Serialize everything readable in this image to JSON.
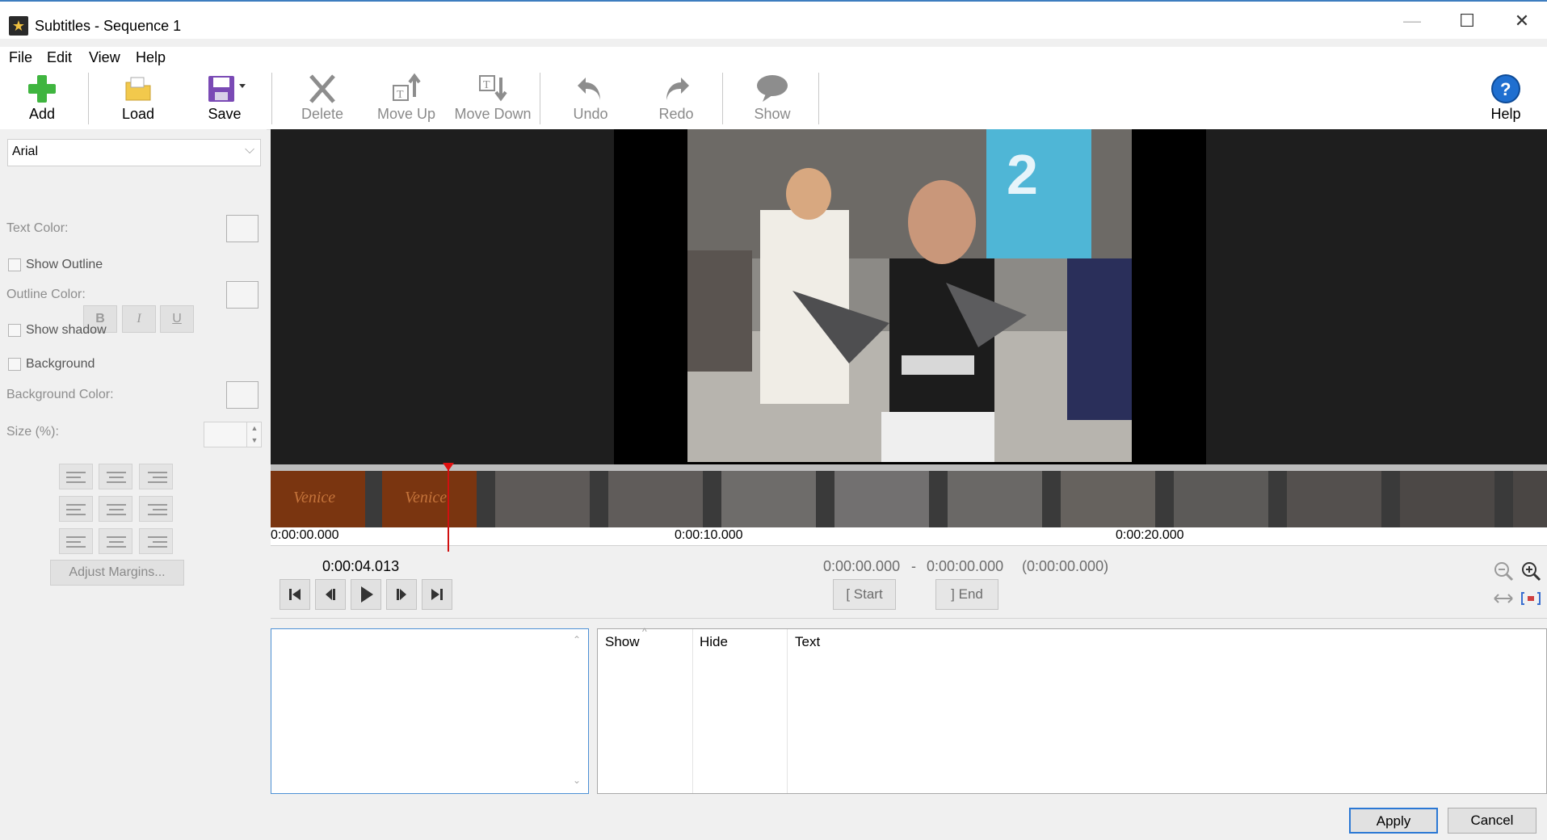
{
  "window": {
    "title": "Subtitles - Sequence 1"
  },
  "menu": [
    "File",
    "Edit",
    "View",
    "Help"
  ],
  "toolbar": {
    "add": "Add",
    "load": "Load",
    "save": "Save",
    "delete": "Delete",
    "move_up": "Move Up",
    "move_down": "Move Down",
    "undo": "Undo",
    "redo": "Redo",
    "show": "Show",
    "help": "Help"
  },
  "format_panel": {
    "font": "Arial",
    "bold": "B",
    "italic": "I",
    "underline": "U",
    "text_color_label": "Text Color:",
    "show_outline_label": "Show Outline",
    "outline_color_label": "Outline Color:",
    "show_shadow_label": "Show shadow",
    "background_label": "Background",
    "background_color_label": "Background Color:",
    "size_label": "Size (%):",
    "size_value": "",
    "adjust_margins": "Adjust Margins...",
    "show_outline_checked": false,
    "show_shadow_checked": false,
    "background_checked": false
  },
  "timeline": {
    "ruler_labels": [
      "0:00:00.000",
      "0:00:10.000",
      "0:00:20.000"
    ],
    "thumb_text": "Venice",
    "current_time": "0:00:04.013",
    "range_start": "0:00:00.000",
    "range_dash": "-",
    "range_end": "0:00:00.000",
    "range_duration": "(0:00:00.000)",
    "start_label": "Start",
    "end_label": "End"
  },
  "grid": {
    "columns": [
      "Show",
      "Hide",
      "Text"
    ]
  },
  "dialog": {
    "apply": "Apply",
    "cancel": "Cancel"
  },
  "colors": {
    "accent": "#3d7dbf",
    "playhead": "#d01010",
    "add_green": "#3fb53f",
    "save_purple": "#7a4ab5",
    "help_blue": "#1f6fd0"
  }
}
